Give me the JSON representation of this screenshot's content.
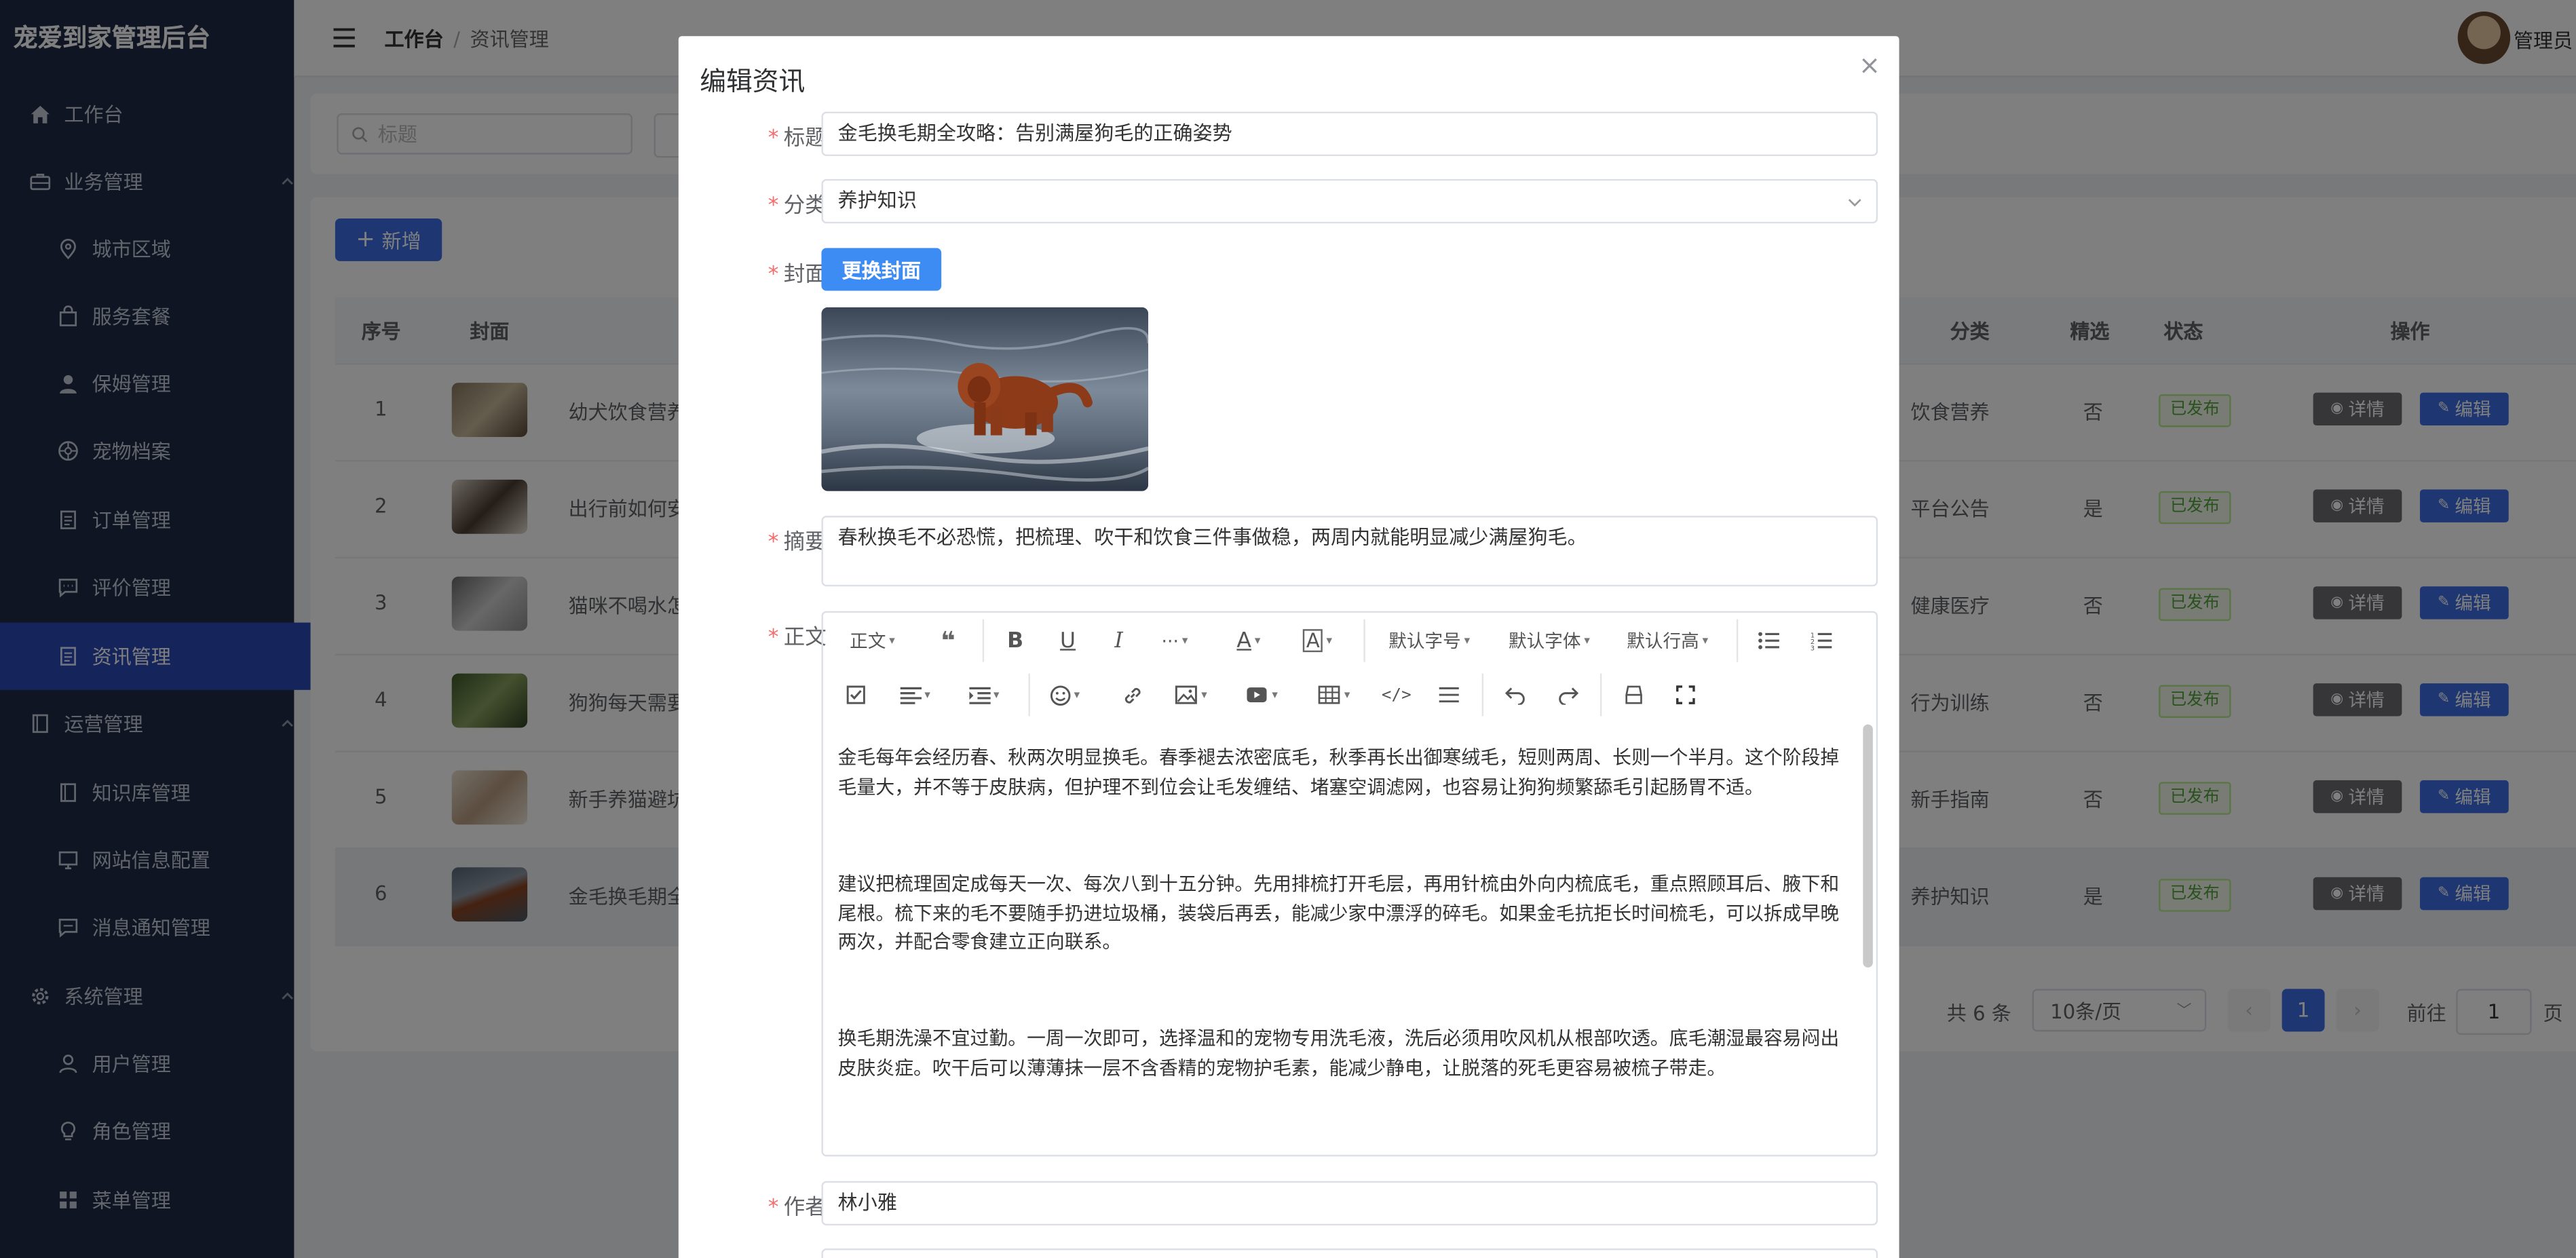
{
  "app": {
    "title": "宠爱到家管理后台",
    "breadcrumb": [
      "工作台",
      "资讯管理"
    ],
    "admin_name": "管理员"
  },
  "sidebar": {
    "items": [
      {
        "label": "工作台",
        "icon": "home-icon"
      },
      {
        "label": "业务管理",
        "icon": "briefcase-icon"
      },
      {
        "label": "城市区域",
        "icon": "location-icon"
      },
      {
        "label": "服务套餐",
        "icon": "bag-icon"
      },
      {
        "label": "保姆管理",
        "icon": "user-icon"
      },
      {
        "label": "宠物档案",
        "icon": "paw-icon"
      },
      {
        "label": "订单管理",
        "icon": "document-icon"
      },
      {
        "label": "评价管理",
        "icon": "chat-icon"
      },
      {
        "label": "资讯管理",
        "icon": "document-icon"
      },
      {
        "label": "运营管理",
        "icon": "book-icon"
      },
      {
        "label": "知识库管理",
        "icon": "book-icon"
      },
      {
        "label": "网站信息配置",
        "icon": "monitor-icon"
      },
      {
        "label": "消息通知管理",
        "icon": "chat-icon"
      },
      {
        "label": "系统管理",
        "icon": "gear-icon"
      },
      {
        "label": "用户管理",
        "icon": "user-icon"
      },
      {
        "label": "角色管理",
        "icon": "bulb-icon"
      },
      {
        "label": "菜单管理",
        "icon": "grid-icon"
      }
    ]
  },
  "search": {
    "placeholder": "标题"
  },
  "toolbar": {
    "add_label": "新增"
  },
  "table": {
    "columns": [
      "序号",
      "封面",
      "分类",
      "精选",
      "状态",
      "操作"
    ],
    "rows": [
      {
        "index": "1",
        "title": "幼犬饮食营养",
        "category": "饮食营养",
        "featured": "否",
        "status": "已发布"
      },
      {
        "index": "2",
        "title": "出行前如何安",
        "category": "平台公告",
        "featured": "是",
        "status": "已发布"
      },
      {
        "index": "3",
        "title": "猫咪不喝水怎",
        "category": "健康医疗",
        "featured": "否",
        "status": "已发布"
      },
      {
        "index": "4",
        "title": "狗狗每天需要",
        "category": "行为训练",
        "featured": "否",
        "status": "已发布"
      },
      {
        "index": "5",
        "title": "新手养猫避坑",
        "category": "新手指南",
        "featured": "否",
        "status": "已发布"
      },
      {
        "index": "6",
        "title": "金毛换毛期全",
        "category": "养护知识",
        "featured": "是",
        "status": "已发布"
      }
    ],
    "detail_label": "详情",
    "edit_label": "编辑"
  },
  "pagination": {
    "total": "共 6 条",
    "page_size": "10条/页",
    "current": "1",
    "goto_label": "前往",
    "goto_value": "1",
    "page_suffix": "页"
  },
  "dialog": {
    "title": "编辑资讯",
    "labels": {
      "title": "标题",
      "category": "分类",
      "cover": "封面",
      "summary": "摘要",
      "body": "正文",
      "author": "作者"
    },
    "title_value": "金毛换毛期全攻略：告别满屋狗毛的正确姿势",
    "category_value": "养护知识",
    "cover_button": "更换封面",
    "summary_value": "春秋换毛不必恐慌，把梳理、吹干和饮食三件事做稳，两周内就能明显减少满屋狗毛。",
    "author_value": "林小雅",
    "editor": {
      "paragraph_style": "正文",
      "font_size": "默认字号",
      "font_family": "默认字体",
      "line_height": "默认行高",
      "paragraphs": [
        "金毛每年会经历春、秋两次明显换毛。春季褪去浓密底毛，秋季再长出御寒绒毛，短则两周、长则一个半月。这个阶段掉毛量大，并不等于皮肤病，但护理不到位会让毛发缠结、堵塞空调滤网，也容易让狗狗频繁舔毛引起肠胃不适。",
        "建议把梳理固定成每天一次、每次八到十五分钟。先用排梳打开毛层，再用针梳由外向内梳底毛，重点照顾耳后、腋下和尾根。梳下来的毛不要随手扔进垃圾桶，装袋后再丢，能减少家中漂浮的碎毛。如果金毛抗拒长时间梳毛，可以拆成早晚两次，并配合零食建立正向联系。",
        "换毛期洗澡不宜过勤。一周一次即可，选择温和的宠物专用洗毛液，洗后必须用吹风机从根部吹透。底毛潮湿最容易闷出皮肤炎症。吹干后可以薄薄抹一层不含香精的宠物护毛素，能减少静电，让脱落的死毛更容易被梳子带走。"
      ]
    }
  }
}
